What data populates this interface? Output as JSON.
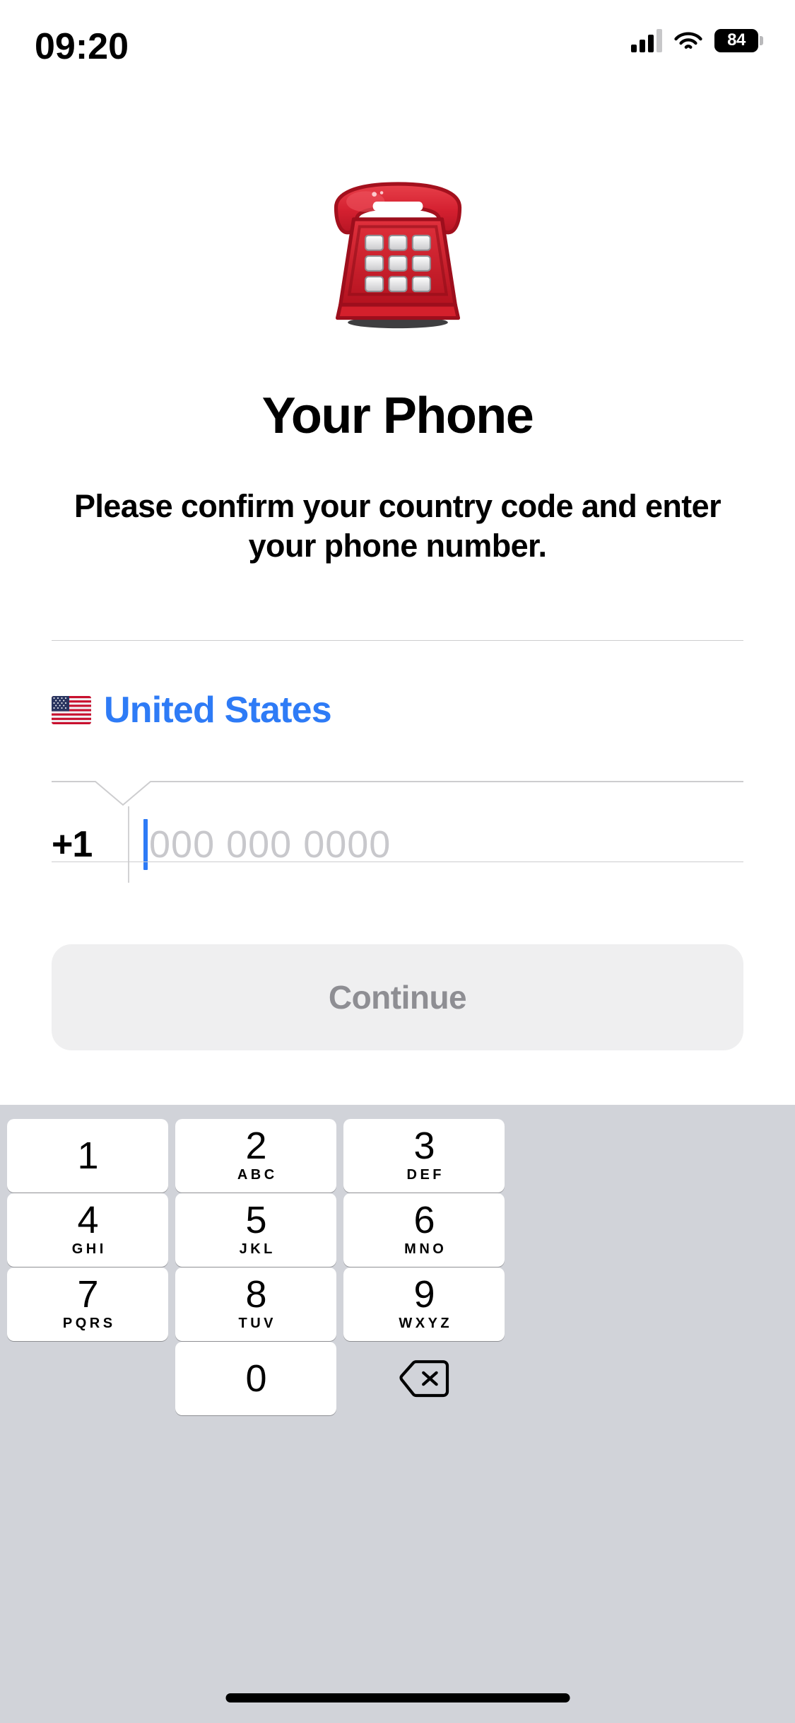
{
  "status_bar": {
    "time": "09:20",
    "signal_icon": "cellular-bars-icon",
    "wifi_icon": "wifi-icon",
    "battery_percent": "84",
    "battery_icon": "battery-icon"
  },
  "hero": {
    "emoji_icon": "telephone-emoji",
    "emoji_char": "☎️",
    "title": "Your Phone",
    "subtitle": "Please confirm your country code and enter your phone number."
  },
  "form": {
    "country": {
      "flag_icon": "flag-united-states-icon",
      "flag_char": "🇺🇸",
      "name": "United States"
    },
    "dial_code": "+1",
    "phone_value": "",
    "phone_placeholder": "000 000 0000",
    "submit_label": "Continue"
  },
  "colors": {
    "accent": "#2e7bf6",
    "keyboard_background": "#d1d3d9",
    "key_background": "#ffffff",
    "button_disabled_background": "#efeff0",
    "button_disabled_text": "#8e8e93",
    "placeholder": "#c8c8cc",
    "rule": "#cdcdcf"
  },
  "keypad": {
    "rows": [
      [
        {
          "digit": "1",
          "letters": ""
        },
        {
          "digit": "2",
          "letters": "ABC"
        },
        {
          "digit": "3",
          "letters": "DEF"
        }
      ],
      [
        {
          "digit": "4",
          "letters": "GHI"
        },
        {
          "digit": "5",
          "letters": "JKL"
        },
        {
          "digit": "6",
          "letters": "MNO"
        }
      ],
      [
        {
          "digit": "7",
          "letters": "PQRS"
        },
        {
          "digit": "8",
          "letters": "TUV"
        },
        {
          "digit": "9",
          "letters": "WXYZ"
        }
      ]
    ],
    "last_row": {
      "zero": {
        "digit": "0",
        "letters": ""
      },
      "delete_icon": "backspace-delete-icon"
    }
  },
  "home_indicator": "home-indicator"
}
